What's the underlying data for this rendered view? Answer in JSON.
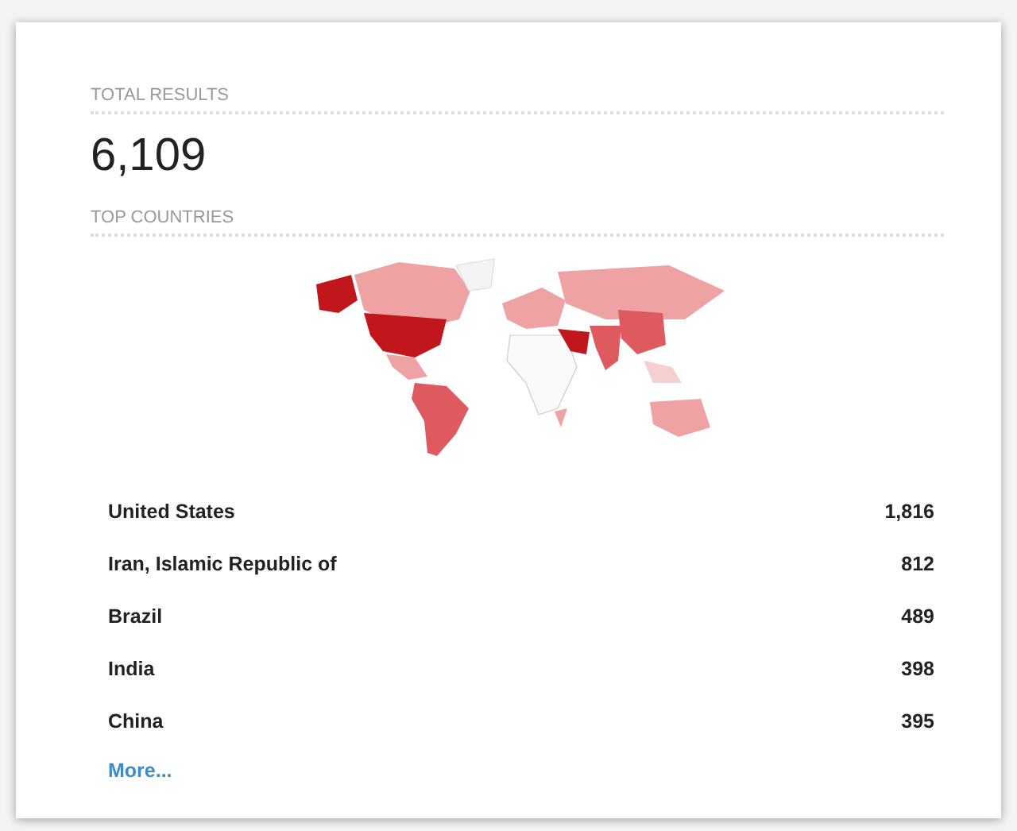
{
  "total_results": {
    "label": "TOTAL RESULTS",
    "value": "6,109"
  },
  "top_countries": {
    "label": "TOP COUNTRIES",
    "rows": [
      {
        "name": "United States",
        "count": "1,816"
      },
      {
        "name": "Iran, Islamic Republic of",
        "count": "812"
      },
      {
        "name": "Brazil",
        "count": "489"
      },
      {
        "name": "India",
        "count": "398"
      },
      {
        "name": "China",
        "count": "395"
      }
    ],
    "more_link": "More..."
  }
}
